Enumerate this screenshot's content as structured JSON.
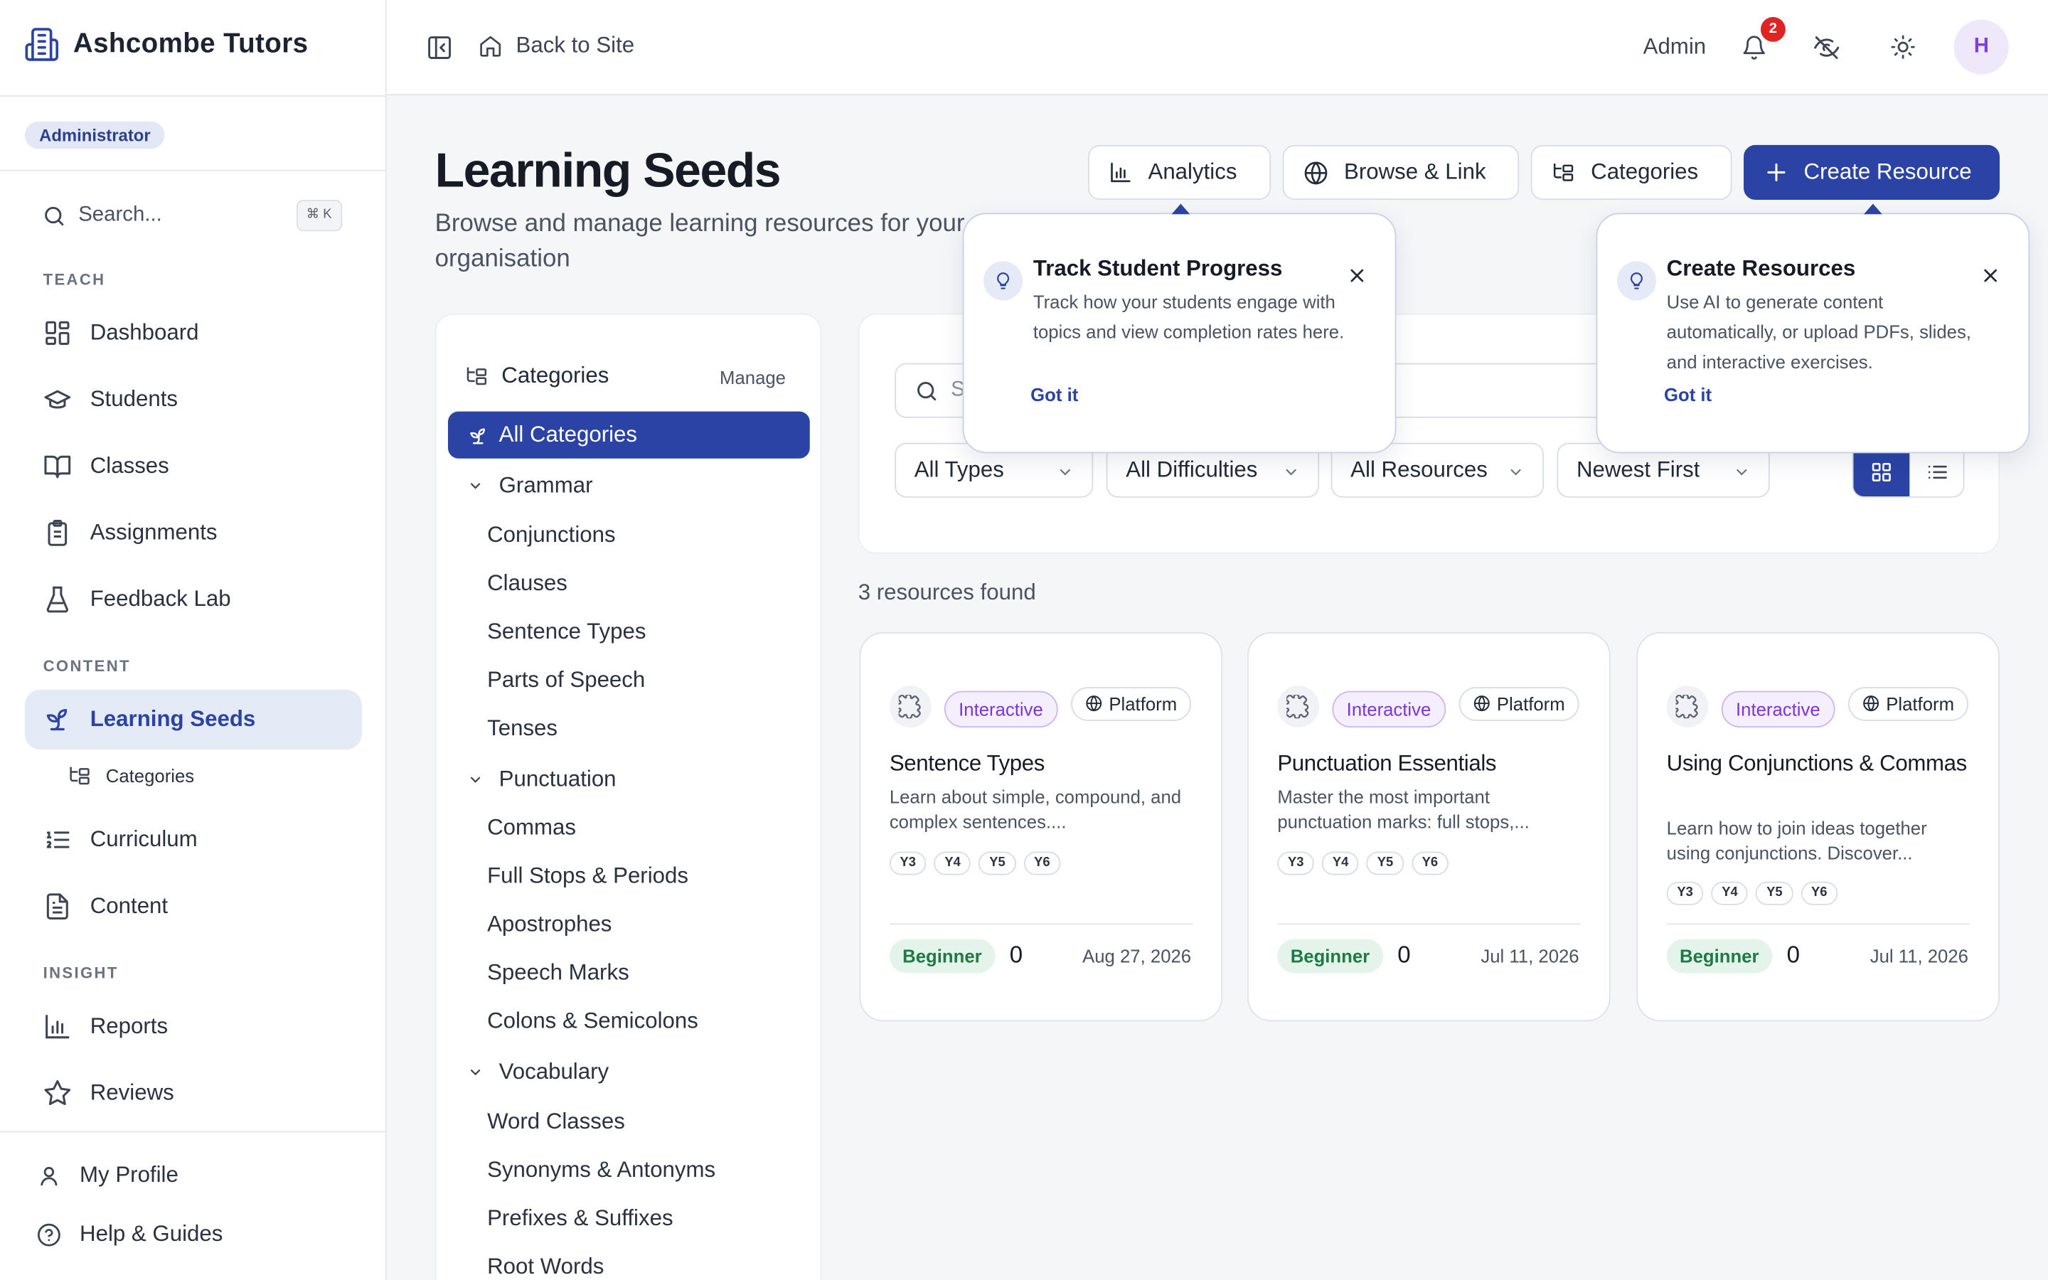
{
  "app": {
    "brand": "Ashcombe Tutors",
    "role": "Administrator"
  },
  "sidebar": {
    "search_label": "Search...",
    "search_shortcut": "⌘ K",
    "sections": {
      "teach": "TEACH",
      "content": "CONTENT",
      "insight": "INSIGHT"
    },
    "items": {
      "dashboard": "Dashboard",
      "students": "Students",
      "classes": "Classes",
      "assignments": "Assignments",
      "feedback_lab": "Feedback Lab",
      "learning_seeds": "Learning Seeds",
      "categories": "Categories",
      "curriculum": "Curriculum",
      "content": "Content",
      "reports": "Reports",
      "reviews": "Reviews"
    },
    "bottom": {
      "profile": "My Profile",
      "help": "Help & Guides"
    }
  },
  "topbar": {
    "back": "Back to Site",
    "admin": "Admin",
    "notif_count": "2",
    "avatar": "H"
  },
  "header": {
    "title": "Learning Seeds",
    "subtitle": "Browse and manage learning resources for your organisation",
    "buttons": {
      "analytics": "Analytics",
      "browse": "Browse & Link",
      "categories": "Categories",
      "create": "Create Resource"
    }
  },
  "categories": {
    "heading": "Categories",
    "manage": "Manage",
    "all": "All Categories",
    "groups": [
      {
        "name": "Grammar",
        "children": [
          "Conjunctions",
          "Clauses",
          "Sentence Types",
          "Parts of Speech",
          "Tenses"
        ]
      },
      {
        "name": "Punctuation",
        "children": [
          "Commas",
          "Full Stops & Periods",
          "Apostrophes",
          "Speech Marks",
          "Colons & Semicolons"
        ]
      },
      {
        "name": "Vocabulary",
        "children": [
          "Word Classes",
          "Synonyms & Antonyms",
          "Prefixes & Suffixes",
          "Root Words"
        ]
      }
    ]
  },
  "filters": {
    "search_placeholder": "S",
    "type": "All Types",
    "difficulty": "All Difficulties",
    "resources": "All Resources",
    "sort": "Newest First"
  },
  "results": {
    "count_text": "3 resources found",
    "cards": [
      {
        "badge": "Interactive",
        "source": "Platform",
        "title": "Sentence Types",
        "description": "Learn about simple, compound, and complex sentences....",
        "years": [
          "Y3",
          "Y4",
          "Y5",
          "Y6"
        ],
        "level": "Beginner",
        "count": "0",
        "date": "Aug 27, 2026"
      },
      {
        "badge": "Interactive",
        "source": "Platform",
        "title": "Punctuation Essentials",
        "description": "Master the most important punctuation marks: full stops,...",
        "years": [
          "Y3",
          "Y4",
          "Y5",
          "Y6"
        ],
        "level": "Beginner",
        "count": "0",
        "date": "Jul 11, 2026"
      },
      {
        "badge": "Interactive",
        "source": "Platform",
        "title": "Using Conjunctions & Commas",
        "description": "Learn how to join ideas together using conjunctions. Discover...",
        "years": [
          "Y3",
          "Y4",
          "Y5",
          "Y6"
        ],
        "level": "Beginner",
        "count": "0",
        "date": "Jul 11, 2026"
      }
    ]
  },
  "tooltips": [
    {
      "title": "Track Student Progress",
      "body": "Track how your students engage with topics and view completion rates here.",
      "action": "Got it"
    },
    {
      "title": "Create Resources",
      "body": "Use AI to generate content automatically, or upload PDFs, slides, and interactive exercises.",
      "action": "Got it"
    }
  ],
  "colors": {
    "primary": "#2a43a5",
    "accent_purple": "#7a36d8",
    "success": "#1d7a45",
    "danger": "#e02424"
  }
}
